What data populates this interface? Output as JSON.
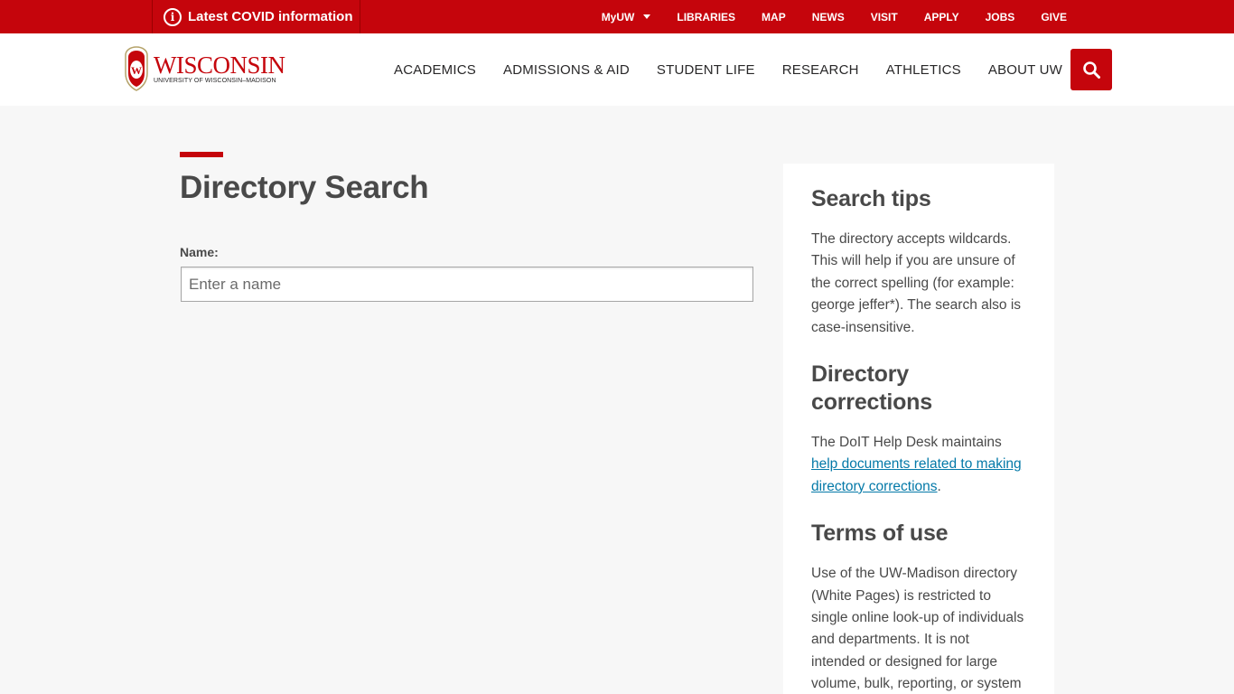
{
  "topbar": {
    "covid_label": "Latest COVID information",
    "links": [
      "MyUW",
      "LIBRARIES",
      "MAP",
      "NEWS",
      "VISIT",
      "APPLY",
      "JOBS",
      "GIVE"
    ]
  },
  "logo": {
    "wordmark": "WISCONSIN",
    "subline": "UNIVERSITY OF WISCONSIN–MADISON",
    "crest_letter": "W"
  },
  "nav": [
    "ACADEMICS",
    "ADMISSIONS & AID",
    "STUDENT LIFE",
    "RESEARCH",
    "ATHLETICS",
    "ABOUT UW"
  ],
  "main": {
    "title": "Directory Search",
    "name_label": "Name:",
    "name_placeholder": "Enter a name",
    "name_value": ""
  },
  "sidebar": {
    "tips_title": "Search tips",
    "tips_text": "The directory accepts wildcards. This will help if you are unsure of the correct spelling (for example: george jeffer*). The search also is case-insensitive.",
    "corrections_title": "Directory corrections",
    "corrections_text": "The DoIT Help Desk maintains ",
    "corrections_link": "help documents related to making directory corrections",
    "corrections_end": ".",
    "terms_title": "Terms of use",
    "terms_text": "Use of the UW-Madison directory (White Pages) is restricted to single online look-up of individuals and departments. It is not intended or designed for large volume, bulk, reporting, or system"
  },
  "colors": {
    "brand_red": "#c5050c",
    "link_blue": "#0479a8",
    "page_bg": "#f7f7f7"
  },
  "icons": {
    "covid": "info-icon",
    "myuw": "caret-down-icon",
    "search": "search-icon"
  }
}
